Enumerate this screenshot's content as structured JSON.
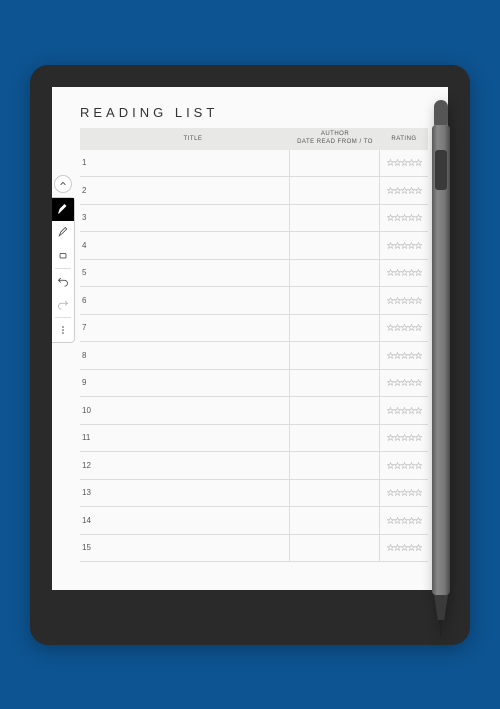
{
  "heading": "READING LIST",
  "columns": {
    "title": "TITLE",
    "author_line1": "AUTHOR",
    "author_line2": "DATE READ FROM / TO",
    "rating": "RATING"
  },
  "rows": [
    {
      "num": "1"
    },
    {
      "num": "2"
    },
    {
      "num": "3"
    },
    {
      "num": "4"
    },
    {
      "num": "5"
    },
    {
      "num": "6"
    },
    {
      "num": "7"
    },
    {
      "num": "8"
    },
    {
      "num": "9"
    },
    {
      "num": "10"
    },
    {
      "num": "11"
    },
    {
      "num": "12"
    },
    {
      "num": "13"
    },
    {
      "num": "14"
    },
    {
      "num": "15"
    }
  ],
  "stars_per_rating": 5,
  "toolbar": {
    "tools": [
      {
        "name": "pen",
        "selected": true
      },
      {
        "name": "highlighter",
        "selected": false
      },
      {
        "name": "eraser",
        "selected": false
      }
    ]
  }
}
